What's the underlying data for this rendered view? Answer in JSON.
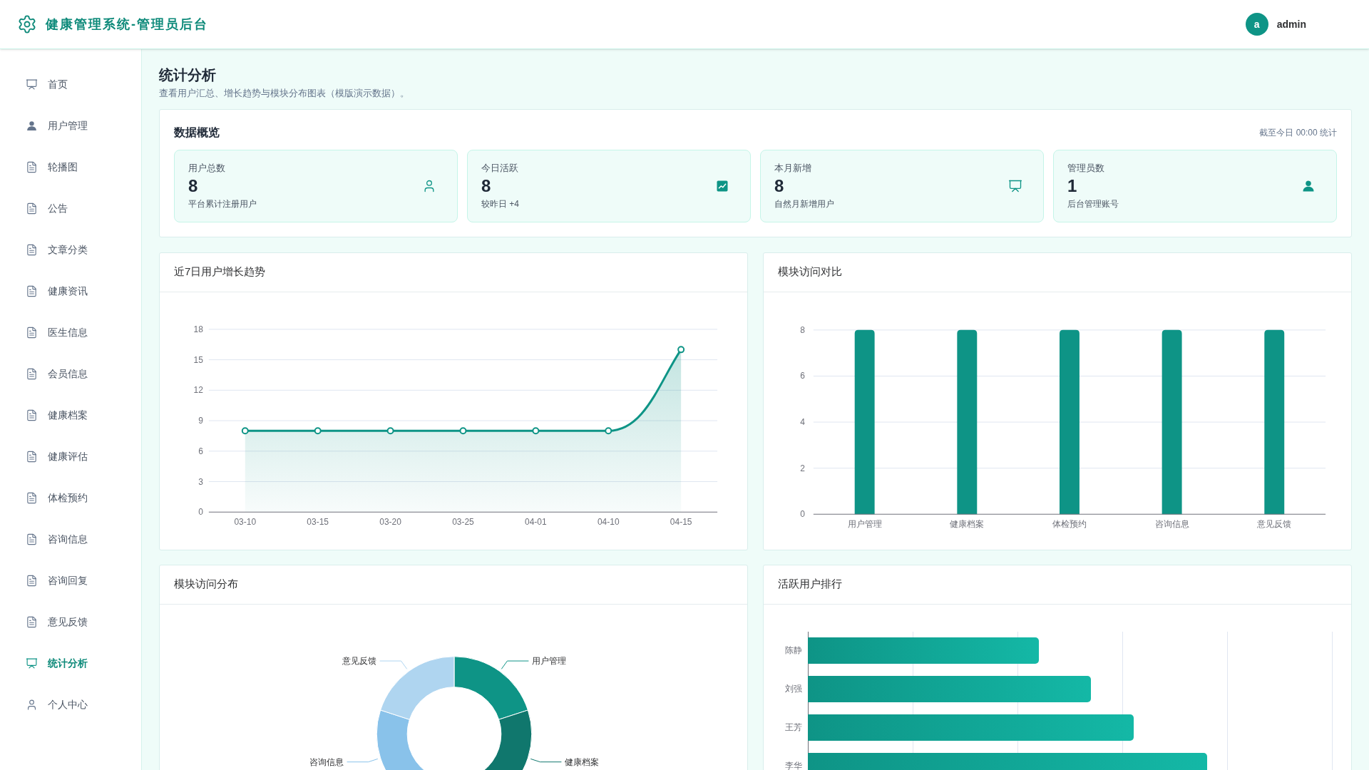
{
  "header": {
    "title": "健康管理系统-管理员后台",
    "avatar": "a",
    "user": "admin"
  },
  "sidebar": {
    "items": [
      {
        "label": "首页",
        "kind": "board",
        "selected": false
      },
      {
        "label": "用户管理",
        "kind": "account",
        "selected": false
      },
      {
        "label": "轮播图",
        "kind": "page",
        "selected": false
      },
      {
        "label": "公告",
        "kind": "page",
        "selected": false
      },
      {
        "label": "文章分类",
        "kind": "page",
        "selected": false
      },
      {
        "label": "健康资讯",
        "kind": "page",
        "selected": false
      },
      {
        "label": "医生信息",
        "kind": "page",
        "selected": false
      },
      {
        "label": "会员信息",
        "kind": "page",
        "selected": false
      },
      {
        "label": "健康档案",
        "kind": "page",
        "selected": false
      },
      {
        "label": "健康评估",
        "kind": "page",
        "selected": false
      },
      {
        "label": "体检预约",
        "kind": "page",
        "selected": false
      },
      {
        "label": "咨询信息",
        "kind": "page",
        "selected": false
      },
      {
        "label": "咨询回复",
        "kind": "page",
        "selected": false
      },
      {
        "label": "意见反馈",
        "kind": "page",
        "selected": false
      },
      {
        "label": "统计分析",
        "kind": "board",
        "selected": true
      },
      {
        "label": "个人中心",
        "kind": "profile",
        "selected": false
      }
    ]
  },
  "page": {
    "title": "统计分析",
    "subtitle": "查看用户汇总、增长趋势与模块分布图表（模版演示数据）。"
  },
  "overview": {
    "title": "数据概览",
    "note": "截至今日 00:00 统计",
    "cards": [
      {
        "label": "用户总数",
        "value": "8",
        "hint": "平台累计注册用户",
        "kind": "profile"
      },
      {
        "label": "今日活跃",
        "value": "8",
        "hint": "较昨日 +4",
        "kind": "trend"
      },
      {
        "label": "本月新增",
        "value": "8",
        "hint": "自然月新增用户",
        "kind": "board"
      },
      {
        "label": "管理员数",
        "value": "1",
        "hint": "后台管理账号",
        "kind": "account"
      }
    ]
  },
  "growth": {
    "title": "近7日用户增长趋势",
    "chart_data": {
      "type": "area",
      "categories": [
        "03-10",
        "03-15",
        "03-20",
        "03-25",
        "04-01",
        "04-10",
        "04-15"
      ],
      "series": [
        {
          "color": "#0e9486",
          "values": [
            8,
            8,
            8,
            8,
            8,
            8,
            16
          ]
        }
      ],
      "ylim": [
        0,
        18
      ],
      "yticks": [
        0,
        3,
        6,
        9,
        12,
        15,
        18
      ],
      "grid": true
    }
  },
  "compare": {
    "title": "模块访问对比",
    "chart_data": {
      "type": "bar",
      "categories": [
        "用户管理",
        "健康档案",
        "体检预约",
        "咨询信息",
        "意见反馈"
      ],
      "series": [
        {
          "color": "#0e9486",
          "values": [
            8,
            8,
            8,
            8,
            8
          ]
        }
      ],
      "ylim": [
        0,
        8
      ],
      "yticks": [
        0,
        2,
        4,
        6,
        8
      ],
      "grid": true
    }
  },
  "distribution": {
    "title": "模块访问分布",
    "slices": [
      {
        "label": "用户管理",
        "color": "#0e9486"
      },
      {
        "label": "健康档案",
        "color": "#10776d"
      },
      {
        "label": "咨询信息",
        "color": "#89c2ea"
      },
      {
        "label": "意见反馈",
        "color": "#afd5f0"
      }
    ]
  },
  "ranking": {
    "title": "活跃用户排行",
    "rows": [
      {
        "name": "陈静"
      },
      {
        "name": "刘强"
      },
      {
        "name": "王芳"
      },
      {
        "name": "李华"
      }
    ]
  }
}
